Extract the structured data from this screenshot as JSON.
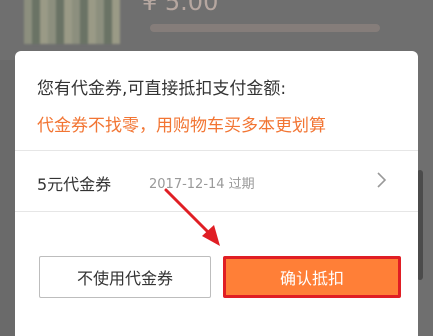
{
  "background": {
    "price_text": "¥ 5.00"
  },
  "dialog": {
    "title": "您有代金券,可直接抵扣支付金额:",
    "note": "代金券不找零，用购物车买多本更划算",
    "coupon": {
      "name": "5元代金券",
      "expire": "2017-12-14 过期",
      "icon": "chevron-right-icon"
    },
    "buttons": {
      "decline_label": "不使用代金券",
      "confirm_label": "确认抵扣"
    }
  },
  "colors": {
    "accent_orange": "#ff7f37",
    "note_orange": "#f27533",
    "annotation_red": "#e01e24",
    "overlay": "#6f6f6f"
  }
}
